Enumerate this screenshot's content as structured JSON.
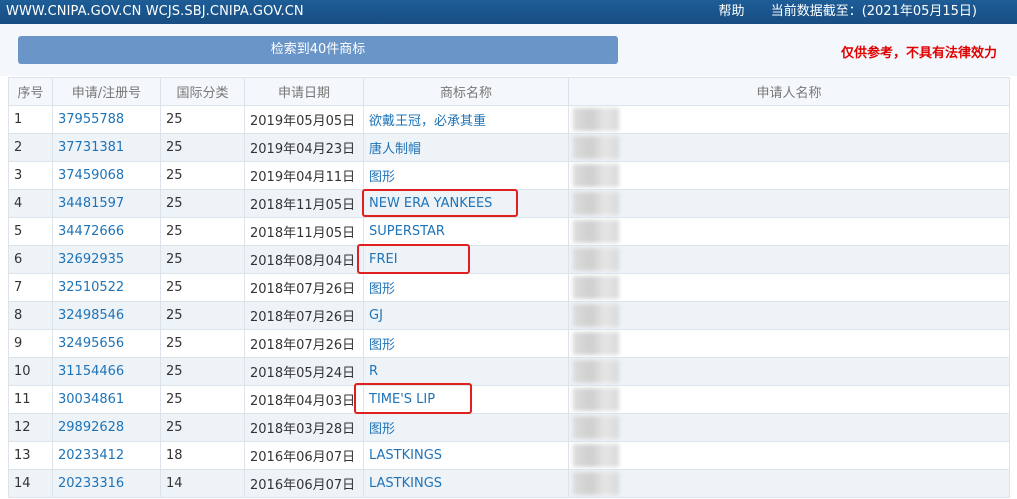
{
  "topbar": {
    "sites": "WWW.CNIPA.GOV.CN WCJS.SBJ.CNIPA.GOV.CN",
    "help": "帮助",
    "data_date": "当前数据截至：(2021年05月15日)"
  },
  "search": {
    "result_label": "检索到40件商标",
    "disclaimer": "仅供参考，不具有法律效力"
  },
  "table": {
    "headers": [
      "序号",
      "申请/注册号",
      "国际分类",
      "申请日期",
      "商标名称",
      "申请人名称"
    ],
    "rows": [
      {
        "no": "1",
        "reg": "37955788",
        "cls": "25",
        "date": "2019年05月05日",
        "name": "欲戴王冠，必承其重"
      },
      {
        "no": "2",
        "reg": "37731381",
        "cls": "25",
        "date": "2019年04月23日",
        "name": "唐人制帽"
      },
      {
        "no": "3",
        "reg": "37459068",
        "cls": "25",
        "date": "2019年04月11日",
        "name": "图形"
      },
      {
        "no": "4",
        "reg": "34481597",
        "cls": "25",
        "date": "2018年11月05日",
        "name": "NEW ERA YANKEES"
      },
      {
        "no": "5",
        "reg": "34472666",
        "cls": "25",
        "date": "2018年11月05日",
        "name": "SUPERSTAR"
      },
      {
        "no": "6",
        "reg": "32692935",
        "cls": "25",
        "date": "2018年08月04日",
        "name": "FREI"
      },
      {
        "no": "7",
        "reg": "32510522",
        "cls": "25",
        "date": "2018年07月26日",
        "name": "图形"
      },
      {
        "no": "8",
        "reg": "32498546",
        "cls": "25",
        "date": "2018年07月26日",
        "name": "GJ"
      },
      {
        "no": "9",
        "reg": "32495656",
        "cls": "25",
        "date": "2018年07月26日",
        "name": "图形"
      },
      {
        "no": "10",
        "reg": "31154466",
        "cls": "25",
        "date": "2018年05月24日",
        "name": "R"
      },
      {
        "no": "11",
        "reg": "30034861",
        "cls": "25",
        "date": "2018年04月03日",
        "name": "TIME'S LIP"
      },
      {
        "no": "12",
        "reg": "29892628",
        "cls": "25",
        "date": "2018年03月28日",
        "name": "图形"
      },
      {
        "no": "13",
        "reg": "20233412",
        "cls": "18",
        "date": "2016年06月07日",
        "name": "LASTKINGS"
      },
      {
        "no": "14",
        "reg": "20233316",
        "cls": "14",
        "date": "2016年06月07日",
        "name": "LASTKINGS"
      }
    ]
  },
  "colors": {
    "topbar_bg": "#1e5d97",
    "button_bg": "#6a95c8",
    "link": "#1f73b7",
    "disclaimer": "#e00000",
    "highlight_box": "#e02020"
  }
}
